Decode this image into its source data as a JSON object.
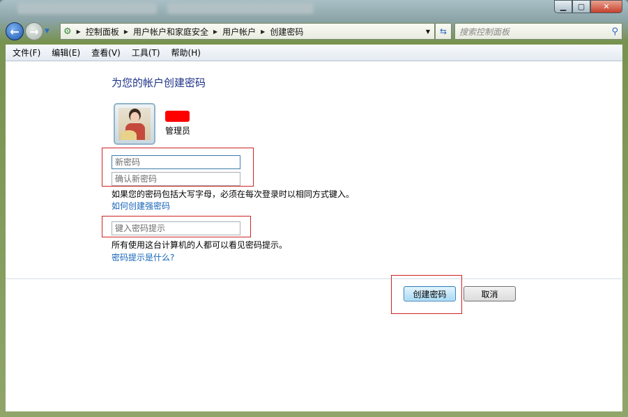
{
  "window": {
    "minimize_icon": "minimize-icon",
    "maximize_icon": "maximize-icon",
    "close_icon": "close-icon"
  },
  "address": {
    "crumbs": [
      "控制面板",
      "用户帐户和家庭安全",
      "用户帐户",
      "创建密码"
    ]
  },
  "search": {
    "placeholder": "搜索控制面板"
  },
  "menu": [
    "文件(F)",
    "编辑(E)",
    "查看(V)",
    "工具(T)",
    "帮助(H)"
  ],
  "main": {
    "title": "为您的帐户创建密码",
    "account_role": "管理员",
    "new_password_placeholder": "新密码",
    "confirm_password_placeholder": "确认新密码",
    "case_note": "如果您的密码包括大写字母，必须在每次登录时以相同方式键入。",
    "strong_link": "如何创建强密码",
    "hint_placeholder": "键入密码提示",
    "hint_note": "所有使用这台计算机的人都可以看见密码提示。",
    "hint_link": "密码提示是什么?",
    "create_button": "创建密码",
    "cancel_button": "取消"
  },
  "colors": {
    "title": "#1e3287",
    "link": "#1565b8",
    "highlight_box": "#cc2222"
  }
}
